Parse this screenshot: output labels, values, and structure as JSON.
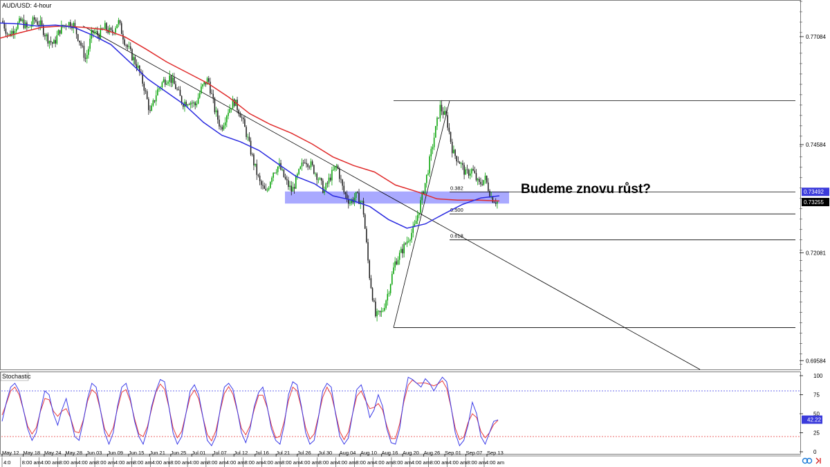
{
  "symbol_label": "AUD/USD: 4-hour",
  "annotation": "Budeme znovu růst?",
  "indicator_label": "Stochastic",
  "chart_data": {
    "type": "candlestick",
    "title": "AUD/USD: 4-hour",
    "ylim": [
      0.6938,
      0.779
    ],
    "price_ticks": [
      "0.77084",
      "0.74584",
      "0.72081",
      "0.69584"
    ],
    "price_tick_values": [
      0.77084,
      0.74584,
      0.72081,
      0.69584
    ],
    "price_badges": [
      {
        "label": "0.73492",
        "value": 0.73492,
        "color": "#3b3bdb"
      },
      {
        "label": "0.73255",
        "value": 0.73255,
        "color": "#000000"
      }
    ],
    "x_labels": [
      "May 12",
      "May 18",
      "May 24",
      "May 28",
      "Jun 03",
      "Jun 09",
      "Jun 15",
      "Jun 21",
      "Jun 25",
      "Jul 01",
      "Jul 07",
      "Jul 12",
      "Jul 16",
      "Jul 21",
      "Jul 26",
      "Jul 30",
      "Aug 04",
      "Aug 10",
      "Aug 16",
      "Aug 20",
      "Aug 26",
      "Sep 01",
      "Sep 07",
      "Sep 13"
    ],
    "time_row_labels": [
      "4:0",
      "8:00 am",
      "4:00 am",
      "8:00 am",
      "4:00 am",
      "8:00 am",
      "4:00 am",
      "8:00 am",
      "4:00 am",
      "8:00 am",
      "4:00 am",
      "8:00 am",
      "4:00 am",
      "8:00 am",
      "4:00 am",
      "8:00 am",
      "4:00 am",
      "8:00 am",
      "4:00 am",
      "8:00 am",
      "4:00 am",
      "8:00 am",
      "4:00 am",
      "8:00 am",
      "4:00 am",
      "8:00 am",
      "4:00 am"
    ],
    "close_path": [
      0.7745,
      0.771,
      0.773,
      0.7745,
      0.7725,
      0.7748,
      0.7735,
      0.7705,
      0.769,
      0.7725,
      0.774,
      0.7738,
      0.77,
      0.7655,
      0.772,
      0.7712,
      0.773,
      0.7715,
      0.7745,
      0.77,
      0.7668,
      0.764,
      0.7595,
      0.753,
      0.758,
      0.7605,
      0.7615,
      0.759,
      0.7555,
      0.756,
      0.755,
      0.759,
      0.761,
      0.754,
      0.7495,
      0.7535,
      0.756,
      0.753,
      0.748,
      0.742,
      0.737,
      0.7345,
      0.7395,
      0.741,
      0.7375,
      0.735,
      0.739,
      0.7425,
      0.741,
      0.7385,
      0.735,
      0.7385,
      0.741,
      0.735,
      0.7325,
      0.734,
      0.732,
      0.716,
      0.706,
      0.707,
      0.712,
      0.7185,
      0.721,
      0.724,
      0.7265,
      0.7325,
      0.739,
      0.747,
      0.7545,
      0.752,
      0.744,
      0.742,
      0.739,
      0.74,
      0.7365,
      0.738,
      0.7335,
      0.7325
    ],
    "sma_blue": [
      0.774,
      0.7738,
      0.7733,
      0.7735,
      0.773,
      0.7712,
      0.769,
      0.765,
      0.761,
      0.758,
      0.755,
      0.751,
      0.748,
      0.7465,
      0.7445,
      0.7415,
      0.7385,
      0.7368,
      0.734,
      0.733,
      0.7315,
      0.7285,
      0.7265,
      0.7275,
      0.7298,
      0.732,
      0.7335,
      0.734
    ],
    "sma_red": [
      0.7705,
      0.7718,
      0.773,
      0.7733,
      0.773,
      0.7725,
      0.7708,
      0.768,
      0.765,
      0.7625,
      0.76,
      0.7568,
      0.753,
      0.7505,
      0.7485,
      0.746,
      0.743,
      0.741,
      0.7395,
      0.7365,
      0.735,
      0.7333,
      0.733,
      0.733,
      0.7328
    ],
    "trendline": {
      "from": 0.7733,
      "to": 0.6938
    },
    "fib_high": 0.756,
    "fib_low": 0.7035,
    "fib_levels": [
      {
        "label": "0.382",
        "value": 0.7349
      },
      {
        "label": "0.500",
        "value": 0.7298
      },
      {
        "label": "0.618",
        "value": 0.7238
      }
    ],
    "zone": {
      "top": 0.735,
      "bottom": 0.7322,
      "color": "#9a9aff"
    },
    "stochastic": {
      "ylim": [
        0,
        100
      ],
      "ticks": [
        "100",
        "75",
        "50",
        "25",
        "0"
      ],
      "overbought": 80,
      "oversold": 20,
      "current_label": "42.22",
      "current": 42.22,
      "values": [
        40,
        65,
        85,
        90,
        80,
        55,
        30,
        15,
        25,
        55,
        80,
        75,
        50,
        35,
        55,
        70,
        45,
        20,
        15,
        40,
        70,
        90,
        85,
        55,
        25,
        10,
        25,
        60,
        85,
        90,
        70,
        40,
        20,
        10,
        30,
        60,
        80,
        95,
        92,
        60,
        25,
        10,
        20,
        50,
        80,
        88,
        75,
        45,
        15,
        8,
        20,
        55,
        85,
        90,
        82,
        55,
        25,
        12,
        30,
        60,
        78,
        85,
        60,
        30,
        15,
        10,
        35,
        75,
        92,
        88,
        60,
        25,
        10,
        15,
        45,
        80,
        90,
        85,
        50,
        20,
        10,
        18,
        50,
        82,
        88,
        70,
        45,
        55,
        75,
        60,
        30,
        12,
        10,
        30,
        70,
        98,
        95,
        90,
        85,
        96,
        90,
        80,
        90,
        98,
        92,
        60,
        25,
        8,
        15,
        35,
        65,
        50,
        20,
        10,
        25,
        40,
        42
      ]
    }
  },
  "colors": {
    "bull": "#00a000",
    "bear": "#1a1a1a",
    "sma_blue": "#2a2ae0",
    "sma_red": "#e02a2a",
    "stoch_k": "#3a3ae8",
    "stoch_d": "#e83a3a"
  }
}
